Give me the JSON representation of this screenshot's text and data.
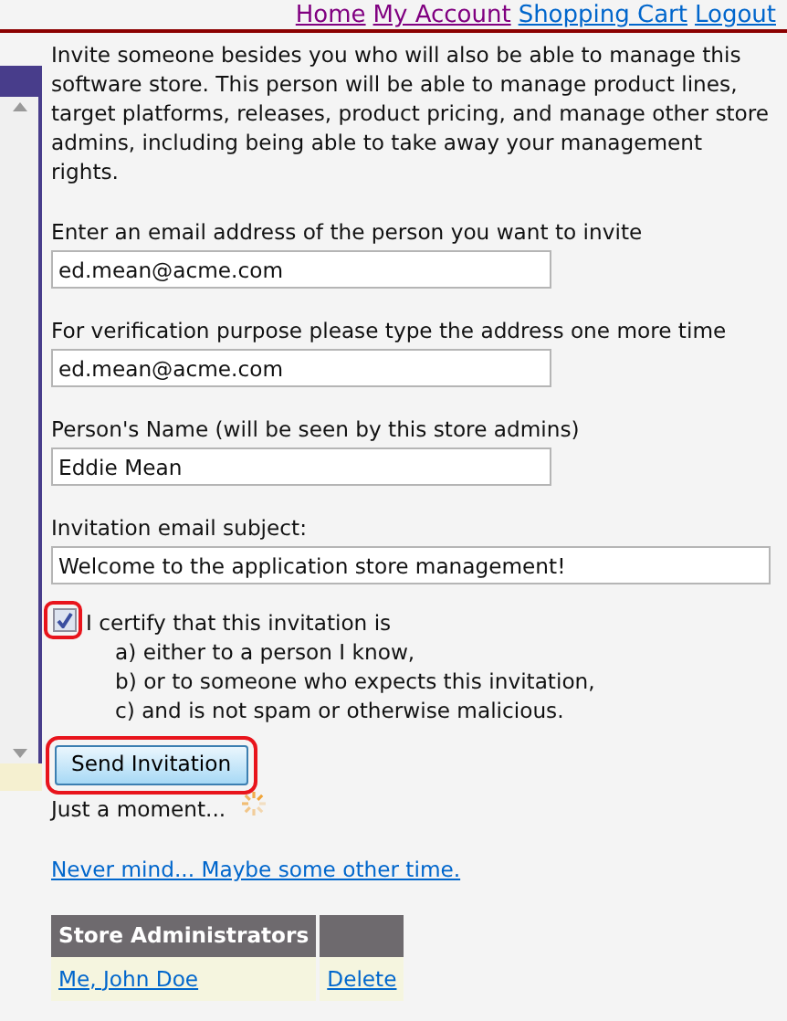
{
  "nav_links": [
    {
      "label": "Home",
      "visited": true
    },
    {
      "label": "My Account",
      "visited": true
    },
    {
      "label": "Shopping Cart",
      "visited": false
    },
    {
      "label": "Logout",
      "visited": false
    }
  ],
  "intro": "Invite someone besides you who will also be able to manage this software store. This person will be able to manage product lines, target platforms, releases, product pricing, and manage other store admins, including being able to take away your management rights.",
  "fields": [
    {
      "label": "Enter an email address of the person you want to invite",
      "value": "ed.mean@acme.com",
      "wide": false
    },
    {
      "label": "For verification purpose please type the address one more time",
      "value": "ed.mean@acme.com",
      "wide": false
    },
    {
      "label": "Person's Name (will be seen by this store admins)",
      "value": "Eddie Mean",
      "wide": false
    },
    {
      "label": "Invitation email subject:",
      "value": "Welcome to the application store management!",
      "wide": true
    }
  ],
  "certify": {
    "checked": true,
    "lines": [
      "I certify that this invitation is",
      "a) either to a person I know,",
      "b) or to someone who expects this invitation,",
      "c) and is not spam or otherwise malicious."
    ]
  },
  "send_button": "Send Invitation",
  "status": "Just a moment...",
  "cancel_link": "Never mind... Maybe some other time.",
  "admins_table": {
    "columns": [
      "Store Administrators"
    ],
    "rows": [
      {
        "name": "Me, John Doe",
        "action": "Delete"
      }
    ]
  }
}
